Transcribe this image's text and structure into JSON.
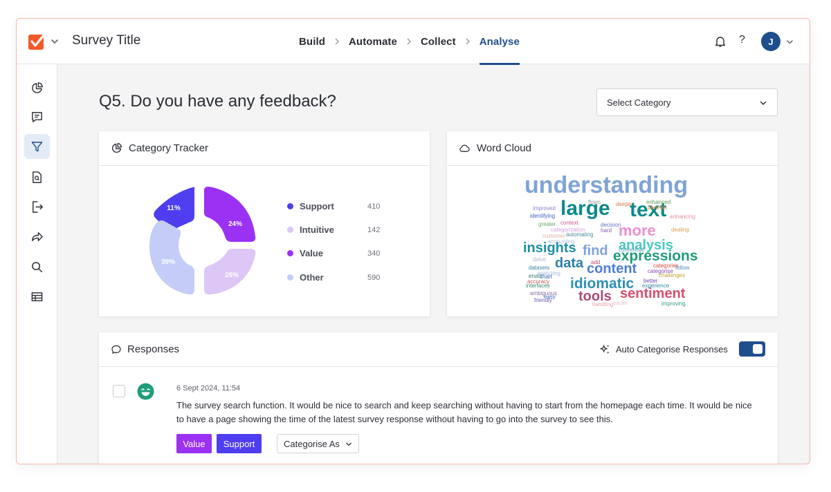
{
  "header": {
    "survey_title": "Survey Title",
    "steps": [
      {
        "label": "Build",
        "active": false
      },
      {
        "label": "Automate",
        "active": false
      },
      {
        "label": "Collect",
        "active": false
      },
      {
        "label": "Analyse",
        "active": true
      }
    ],
    "help_label": "?",
    "avatar_initial": "J"
  },
  "sidebar": {
    "items": [
      {
        "icon": "pie-chart-icon",
        "active": false
      },
      {
        "icon": "message-square-icon",
        "active": false
      },
      {
        "icon": "filter-icon",
        "active": true
      },
      {
        "icon": "file-search-icon",
        "active": false
      },
      {
        "icon": "export-icon",
        "active": false
      },
      {
        "icon": "share-forward-icon",
        "active": false
      },
      {
        "icon": "search-icon",
        "active": false
      },
      {
        "icon": "table-icon",
        "active": false
      }
    ]
  },
  "question": "Q5. Do you have any feedback?",
  "category_select": {
    "value": "Select Category"
  },
  "category_tracker": {
    "title": "Category Tracker",
    "legend": [
      {
        "label": "Support",
        "count": "410",
        "color": "#4f3df0"
      },
      {
        "label": "Intuitive",
        "count": "142",
        "color": "#dcc7f7"
      },
      {
        "label": "Value",
        "count": "340",
        "color": "#9b31f2"
      },
      {
        "label": "Other",
        "count": "590",
        "color": "#c4cdf7"
      }
    ],
    "donut_labels": {
      "support": "11%",
      "value": "24%",
      "intuitive": "26%",
      "other": "39%"
    }
  },
  "word_cloud": {
    "title": "Word Cloud",
    "words": [
      {
        "text": "understanding",
        "color": "#7ea3d6"
      },
      {
        "text": "large",
        "color": "#0f8a8c"
      },
      {
        "text": "text",
        "color": "#0f8a8c"
      },
      {
        "text": "more",
        "color": "#ee8fd2"
      },
      {
        "text": "analysis",
        "color": "#48c9c0"
      },
      {
        "text": "insights",
        "color": "#1d8fa6"
      },
      {
        "text": "find",
        "color": "#7fa1e0"
      },
      {
        "text": "expressions",
        "color": "#1f9d7a"
      },
      {
        "text": "data",
        "color": "#2c7fa8"
      },
      {
        "text": "content",
        "color": "#4d7ed6"
      },
      {
        "text": "idiomatic",
        "color": "#2e8fb4"
      },
      {
        "text": "sentiment",
        "color": "#d64f6e"
      },
      {
        "text": "tools",
        "color": "#a84b7a"
      },
      {
        "text": "improved",
        "color": "#8a7bc9"
      },
      {
        "text": "flows",
        "color": "#9aa0a8"
      },
      {
        "text": "deeper",
        "color": "#e07a4b"
      },
      {
        "text": "enhanced",
        "color": "#5a9f4e"
      },
      {
        "text": "benefits",
        "color": "#d98a3e"
      },
      {
        "text": "identifying",
        "color": "#3a5fc2"
      },
      {
        "text": "enhancing",
        "color": "#e58fa0"
      },
      {
        "text": "greater",
        "color": "#6bab6b"
      },
      {
        "text": "context",
        "color": "#c85a8a"
      },
      {
        "text": "categorization",
        "color": "#d69adf"
      },
      {
        "text": "hard",
        "color": "#8a5ab8"
      },
      {
        "text": "decision",
        "color": "#6a6fc0"
      },
      {
        "text": "dealing",
        "color": "#e0a04b"
      },
      {
        "text": "customer",
        "color": "#e8b3a8"
      },
      {
        "text": "automating",
        "color": "#4e8a9f"
      },
      {
        "text": "accounting",
        "color": "#a8c0dc"
      },
      {
        "text": "contextual",
        "color": "#5a9fb4"
      },
      {
        "text": "delve",
        "color": "#b0b8d0"
      },
      {
        "text": "add",
        "color": "#c04a6a"
      },
      {
        "text": "categories",
        "color": "#d84a3e"
      },
      {
        "text": "datasets",
        "color": "#3a7fa8"
      },
      {
        "text": "analyzing",
        "color": "#a0b8e0"
      },
      {
        "text": "categorise",
        "color": "#8a4ab8"
      },
      {
        "text": "follow",
        "color": "#4e8ab8"
      },
      {
        "text": "enact",
        "color": "#3a7a6a"
      },
      {
        "text": "chart",
        "color": "#2e6ab8"
      },
      {
        "text": "challenges",
        "color": "#c8a030"
      },
      {
        "text": "accuracy",
        "color": "#c05a5a"
      },
      {
        "text": "better",
        "color": "#6a4ab8"
      },
      {
        "text": "interfaces",
        "color": "#3a8a6a"
      },
      {
        "text": "experience",
        "color": "#2e8a9f"
      },
      {
        "text": "ambiguous",
        "color": "#8a6a9f"
      },
      {
        "text": "easy",
        "color": "#3a6ab8"
      },
      {
        "text": "friendly",
        "color": "#6a5ab8"
      },
      {
        "text": "handling",
        "color": "#e8a0a8"
      },
      {
        "text": "easier",
        "color": "#e0c0d0"
      },
      {
        "text": "improving",
        "color": "#2ea08a"
      }
    ]
  },
  "responses": {
    "title": "Responses",
    "auto_categorise_label": "Auto Categorise Responses",
    "auto_categorise_on": true,
    "items": [
      {
        "timestamp": "6 Sept 2024, 11:54",
        "text": "The survey search function. It would be nice to search and keep searching without having to start from the homepage each time. It would be nice to have a page showing the time of the latest survey response without having to go into the survey to see this.",
        "tags": [
          {
            "label": "Value",
            "color": "#9b31f2"
          },
          {
            "label": "Support",
            "color": "#4f3df0"
          }
        ],
        "categorise_label": "Categorise As"
      }
    ]
  }
}
